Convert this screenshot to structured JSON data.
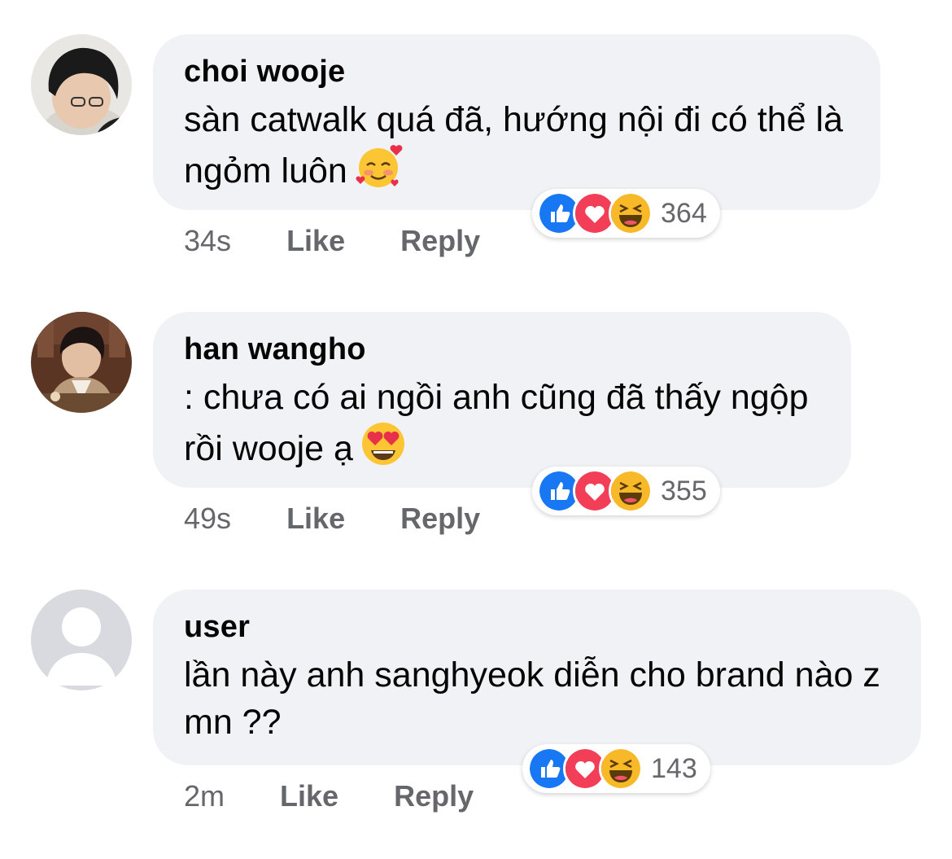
{
  "comments": [
    {
      "author": "choi wooje",
      "text": "sàn catwalk quá đã, hướng nội đi có thể là ngỏm luôn",
      "emoji": "smiling-face-with-hearts",
      "time": "34s",
      "like_label": "Like",
      "reply_label": "Reply",
      "reaction_count": "364",
      "reactions": [
        "like",
        "love",
        "haha"
      ]
    },
    {
      "author": "han wangho",
      "text": ": chưa có ai ngồi anh cũng đã thấy ngộp rồi wooje ạ",
      "emoji": "heart-eyes",
      "time": "49s",
      "like_label": "Like",
      "reply_label": "Reply",
      "reaction_count": "355",
      "reactions": [
        "like",
        "love",
        "haha"
      ]
    },
    {
      "author": "user",
      "text": "lần này anh sanghyeok diễn cho brand nào z mn ??",
      "emoji": "",
      "time": "2m",
      "like_label": "Like",
      "reply_label": "Reply",
      "reaction_count": "143",
      "reactions": [
        "like",
        "love",
        "haha"
      ]
    }
  ],
  "colors": {
    "bubble": "#f0f2f5",
    "meta_text": "#65676b",
    "like_blue": "#1877f2",
    "love_red": "#f33e58",
    "haha_yellow": "#f7b928"
  }
}
